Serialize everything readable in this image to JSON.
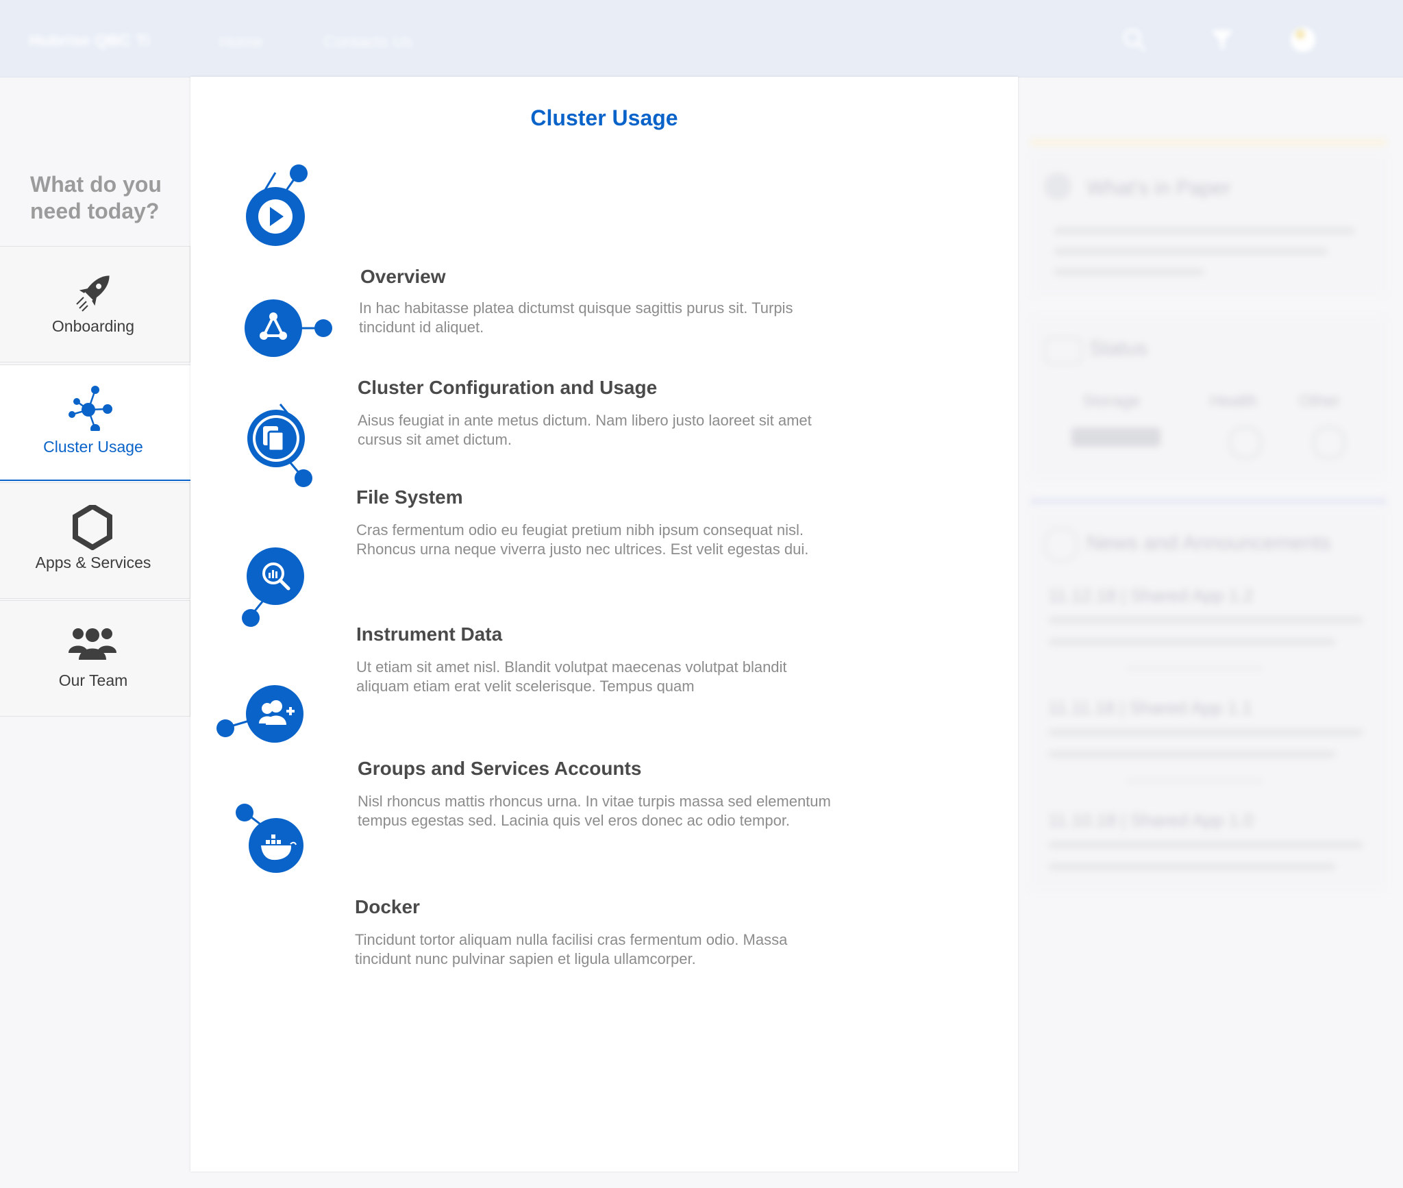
{
  "topbar": {
    "brand": "Hubrise QBC Ti",
    "nav": [
      "Home",
      "Contacts Us"
    ]
  },
  "sidebar": {
    "question": "What do you need today?",
    "items": [
      {
        "label": "Onboarding",
        "icon": "rocket-icon",
        "active": false
      },
      {
        "label": "Cluster Usage",
        "icon": "network-icon",
        "active": true
      },
      {
        "label": "Apps & Services",
        "icon": "hexagon-icon",
        "active": false
      },
      {
        "label": "Our Team",
        "icon": "team-icon",
        "active": false
      }
    ]
  },
  "main": {
    "title": "Cluster Usage",
    "topics": [
      {
        "title": "Overview",
        "desc": "In hac habitasse platea dictumst quisque sagittis purus sit. Turpis tincidunt id aliquet.",
        "icon": "play-icon"
      },
      {
        "title": "Cluster Configuration and Usage",
        "desc": "Aisus feugiat in ante metus dictum. Nam libero justo laoreet sit amet cursus sit amet dictum.",
        "icon": "cluster-config-icon"
      },
      {
        "title": "File System",
        "desc": "Cras fermentum odio eu feugiat pretium nibh ipsum consequat nisl. Rhoncus urna neque viverra justo nec ultrices. Est velit egestas dui.",
        "icon": "file-copy-icon"
      },
      {
        "title": "Instrument Data",
        "desc": "Ut etiam sit amet nisl. Blandit volutpat maecenas volutpat blandit aliquam etiam erat velit scelerisque. Tempus quam",
        "icon": "data-search-icon"
      },
      {
        "title": "Groups and Services Accounts",
        "desc": "Nisl rhoncus mattis rhoncus urna. In vitae turpis massa sed elementum tempus egestas sed. Lacinia quis vel eros donec ac odio tempor.",
        "icon": "add-group-icon"
      },
      {
        "title": "Docker",
        "desc": "Tincidunt tortor aliquam nulla facilisi cras fermentum odio. Massa tincidunt nunc pulvinar sapien et ligula ullamcorper.",
        "icon": "docker-icon"
      }
    ]
  },
  "right_panel": {
    "whats_new": "What's in Paper",
    "status": "Status",
    "status_cols": [
      "Storage",
      "Health",
      "Other"
    ],
    "news": "News and Announcements",
    "news_items": [
      "11.12.18 | Shared App 1.2",
      "11.11.18 | Shared App 1.1",
      "11.10.18 | Shared App 1.0"
    ]
  },
  "colors": {
    "accent": "#0a63c9",
    "title_text": "#4a4a4a",
    "desc_text": "#8c8c8c",
    "question_text": "#9b9b9b",
    "topbar_bg": "#e8edf6"
  }
}
